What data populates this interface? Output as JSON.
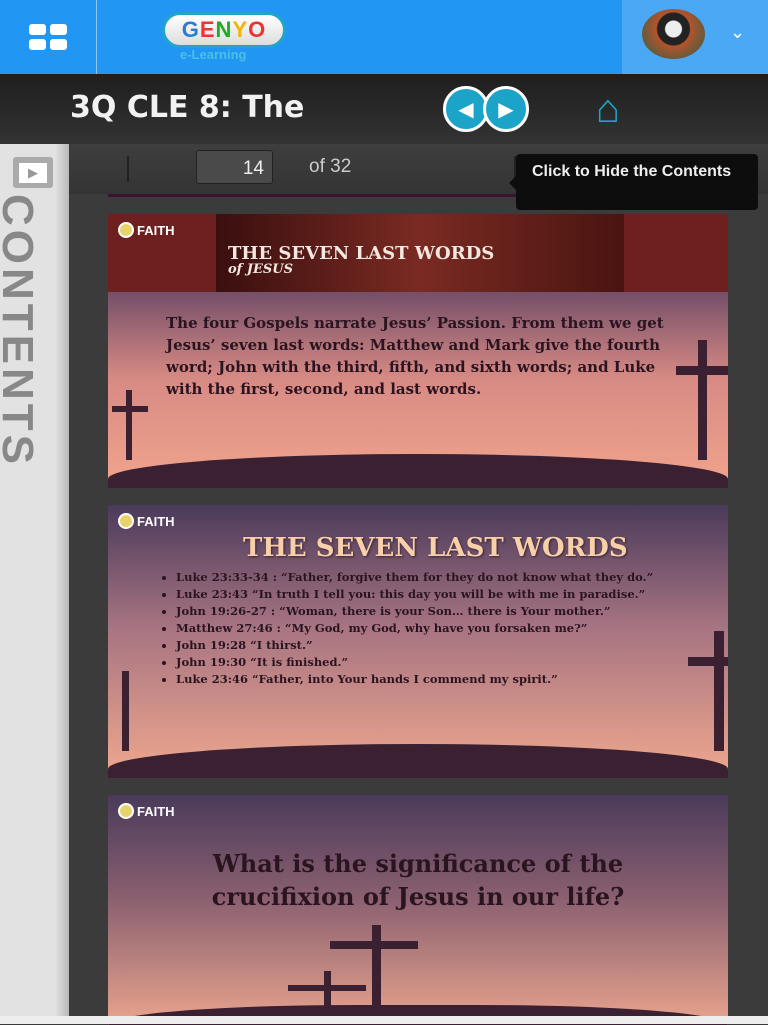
{
  "header": {
    "logo_text": "GENYO",
    "logo_sub": "e-Learning"
  },
  "lesson": {
    "title": "3Q CLE 8: The"
  },
  "sidebar": {
    "label": "CONTENTS"
  },
  "toolbar": {
    "page": "14",
    "of_label": "of 32"
  },
  "tooltip": "Click to Hide the Contents",
  "slides": [
    {
      "logo": "FAITH",
      "banner_title": "THE SEVEN LAST WORDS",
      "banner_sub": "of JESUS",
      "text": "The four Gospels narrate Jesus’ Passion. From them we get Jesus’ seven last words: Matthew and Mark give the fourth word; John with the third, fifth, and sixth words; and Luke with the first, second, and last words."
    },
    {
      "logo": "FAITH",
      "title": "THE SEVEN LAST WORDS",
      "items": [
        "Luke 23:33-34 : “Father, forgive them for they do not know what they do.”",
        "Luke 23:43 “In truth I tell you: this day you will be with me in paradise.”",
        "John 19:26-27 : “Woman, there is your Son… there is Your mother.”",
        "Matthew 27:46 :  “My God, my God, why have you forsaken me?”",
        "John 19:28 “I thirst.”",
        "John 19:30 “It is finished.”",
        "Luke 23:46 “Father, into Your hands I commend my spirit.”"
      ]
    },
    {
      "logo": "FAITH",
      "title": "What is the significance of the crucifixion of Jesus in our life?"
    }
  ]
}
